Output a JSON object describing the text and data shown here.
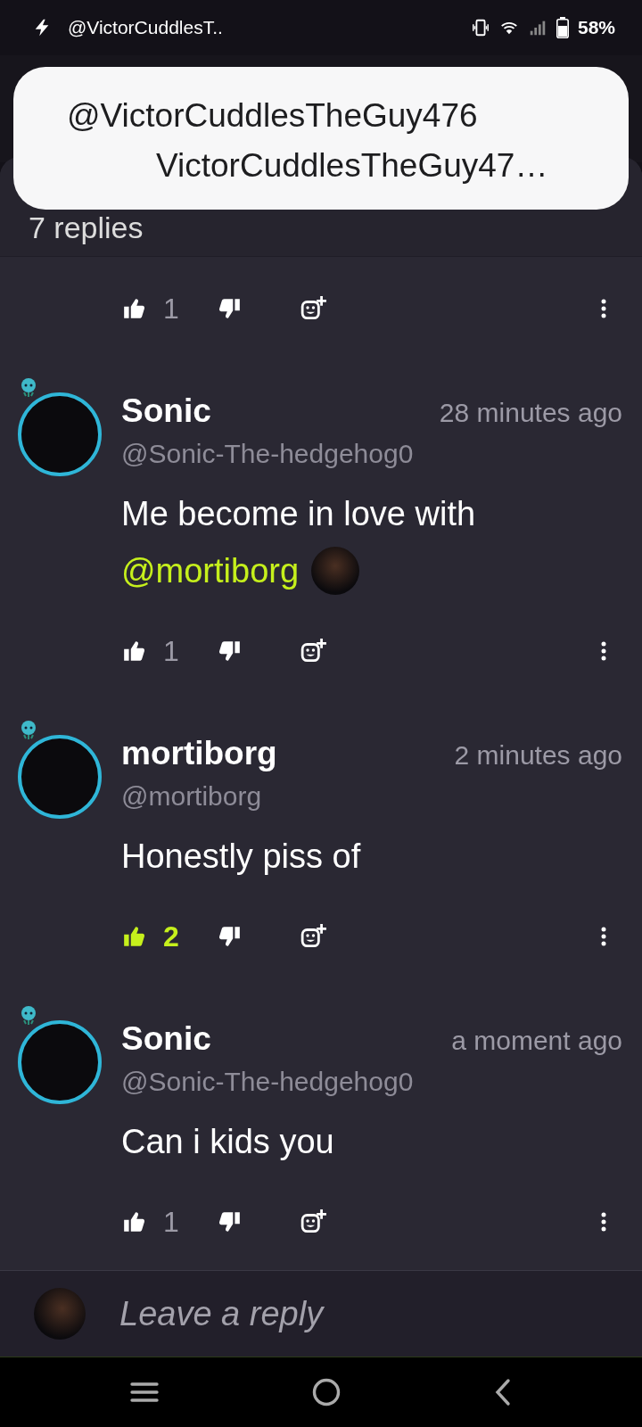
{
  "status_bar": {
    "notification": "@VictorCuddlesT..",
    "battery": "58%"
  },
  "toast": {
    "title": "@VictorCuddlesTheGuy476",
    "subtitle": "VictorCuddlesTheGuy47…"
  },
  "sheet": {
    "title": "7 replies"
  },
  "first_actions": {
    "liked": false,
    "likes": "1"
  },
  "comments": [
    {
      "name": "Sonic",
      "time": "28 minutes ago",
      "handle": "@Sonic-The-hedgehog0",
      "body": "Me become in love with",
      "mention": "@mortiborg",
      "liked": false,
      "likes": "1"
    },
    {
      "name": "mortiborg",
      "time": "2 minutes ago",
      "handle": "@mortiborg",
      "body": "Honestly piss of",
      "liked": true,
      "likes": "2"
    },
    {
      "name": "Sonic",
      "time": "a moment ago",
      "handle": "@Sonic-The-hedgehog0",
      "body": "Can i kids you",
      "liked": false,
      "likes": "1"
    }
  ],
  "reply_bar": {
    "placeholder": "Leave a reply"
  }
}
